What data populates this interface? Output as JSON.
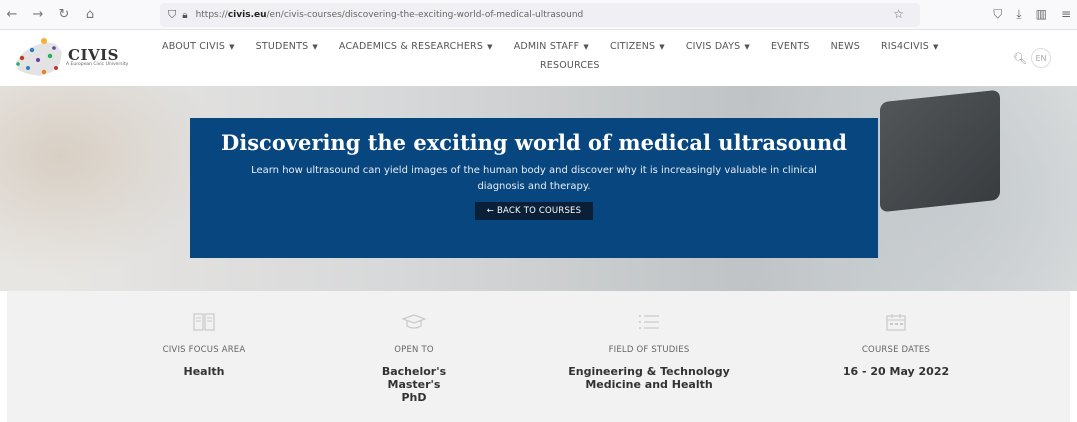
{
  "browser": {
    "url_prefix": "https://",
    "url_domain": "civis.eu",
    "url_path": "/en/civis-courses/discovering-the-exciting-world-of-medical-ultrasound"
  },
  "site": {
    "logo_title": "CIVIS",
    "logo_subtitle": "A European Civic University",
    "nav": [
      {
        "label": "ABOUT CIVIS",
        "dropdown": true
      },
      {
        "label": "STUDENTS",
        "dropdown": true
      },
      {
        "label": "ACADEMICS & RESEARCHERS",
        "dropdown": true
      },
      {
        "label": "ADMIN STAFF",
        "dropdown": true
      },
      {
        "label": "CITIZENS",
        "dropdown": true
      },
      {
        "label": "CIVIS DAYS",
        "dropdown": true
      },
      {
        "label": "EVENTS",
        "dropdown": false
      },
      {
        "label": "NEWS",
        "dropdown": false
      },
      {
        "label": "RIS4CIVIS",
        "dropdown": true
      }
    ],
    "nav_row2": "RESOURCES",
    "lang": "EN"
  },
  "hero": {
    "title": "Discovering the exciting world of medical ultrasound",
    "description": "Learn how ultrasound can yield images of the human body and discover why it is increasingly valuable in clinical diagnosis and therapy.",
    "back_label": "← BACK TO COURSES",
    "card_color": "#08467f"
  },
  "info": [
    {
      "icon": "book-icon",
      "label": "CIVIS FOCUS AREA",
      "value": [
        "Health"
      ]
    },
    {
      "icon": "graduation-cap-icon",
      "label": "OPEN TO",
      "value": [
        "Bachelor's",
        "Master's",
        "PhD"
      ]
    },
    {
      "icon": "list-icon",
      "label": "FIELD OF STUDIES",
      "value": [
        "Engineering & Technology",
        "Medicine and Health"
      ]
    },
    {
      "icon": "calendar-icon",
      "label": "COURSE DATES",
      "value": [
        "16 - 20 May 2022"
      ]
    }
  ]
}
